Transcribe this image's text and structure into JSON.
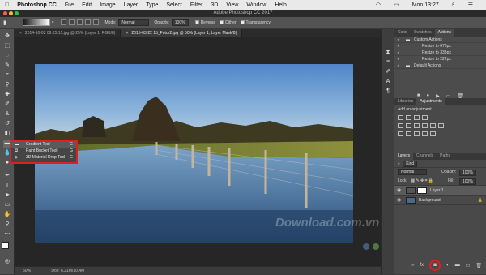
{
  "menubar": {
    "apple": "",
    "app": "Photoshop CC",
    "items": [
      "File",
      "Edit",
      "Image",
      "Layer",
      "Type",
      "Select",
      "Filter",
      "3D",
      "View",
      "Window",
      "Help"
    ],
    "clock": "Mon 13:27"
  },
  "window_title": "Adobe Photoshop CC 2017",
  "options": {
    "mode_label": "Mode:",
    "mode_value": "Normal",
    "opacity_label": "Opacity:",
    "opacity_value": "100%",
    "reverse": "Reverse",
    "dither": "Dither",
    "transparency": "Transparency"
  },
  "tabs": [
    {
      "label": "2014-10-02 09.25.15.jpg @ 25% (Layer 1, RGB/8)"
    },
    {
      "label": "2015-03-22 15_Fotor2.jpg @ 50% (Layer 1, Layer Mask/8)"
    }
  ],
  "flyout": {
    "items": [
      {
        "label": "Gradient Tool",
        "key": "G"
      },
      {
        "label": "Paint Bucket Tool",
        "key": "G"
      },
      {
        "label": "3D Material Drop Tool",
        "key": "G"
      }
    ]
  },
  "status": {
    "zoom": "50%",
    "doc": "Doc: 6.21M/10.4M"
  },
  "watermark": "Download.com.vn",
  "actions_panel": {
    "tabs": [
      "Color",
      "Swatches",
      "Actions"
    ],
    "rows": [
      "Custom Actions",
      "Resize to 670px",
      "Resize to 333px",
      "Resize to 222px",
      "Default Actions"
    ]
  },
  "adjust_panel": {
    "tabs": [
      "Libraries",
      "Adjustments"
    ],
    "heading": "Add an adjustment"
  },
  "layers_panel": {
    "tabs": [
      "Layers",
      "Channels",
      "Paths"
    ],
    "kind": "Kind",
    "blend": "Normal",
    "opacity_label": "Opacity:",
    "opacity_value": "100%",
    "lock_label": "Lock:",
    "fill_label": "Fill:",
    "fill_value": "100%",
    "layers": [
      "Layer 1",
      "Background"
    ]
  },
  "colors": {
    "highlight": "#e02020",
    "panel": "#494949",
    "canvas": "#262626"
  }
}
